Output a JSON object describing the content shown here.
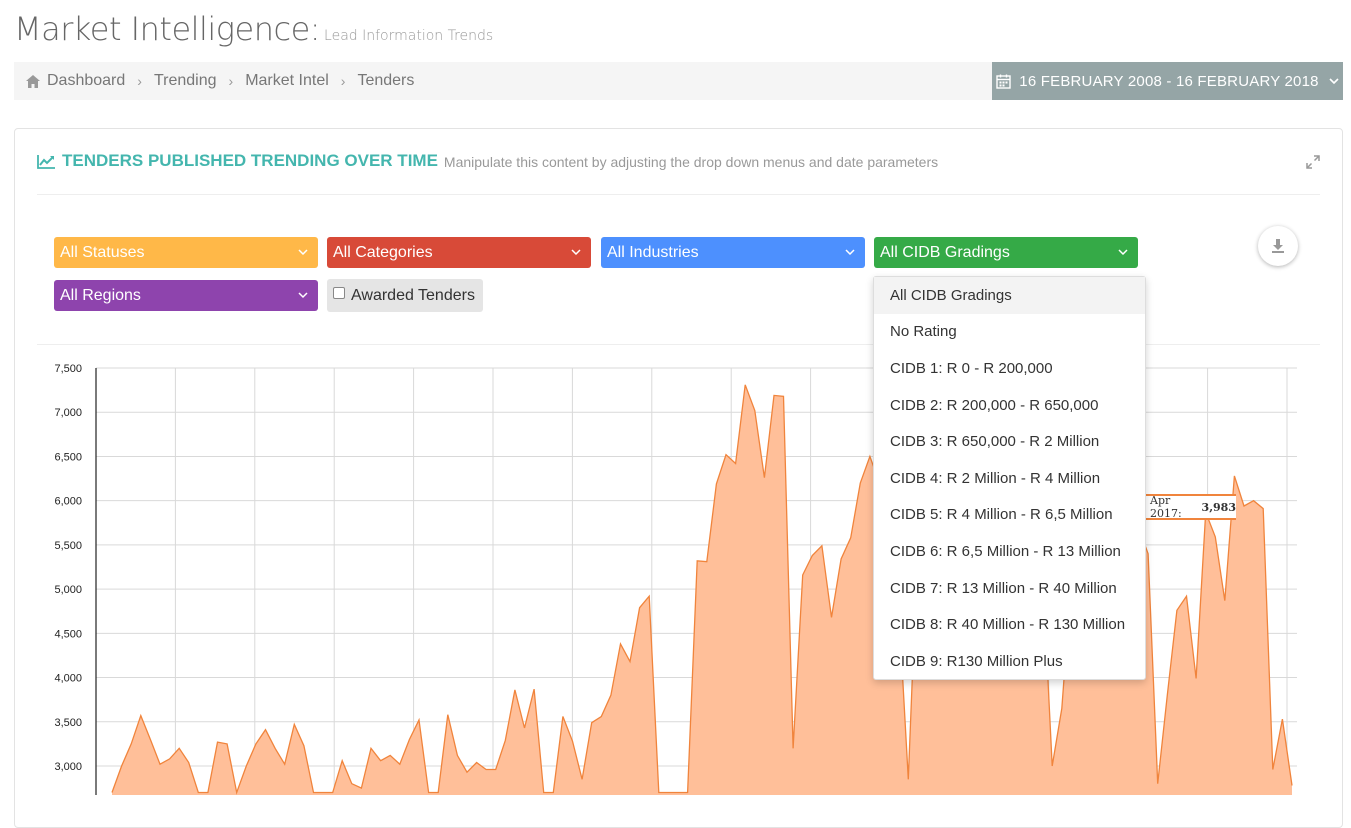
{
  "header": {
    "title": "Market Intelligence:",
    "subtitle": "Lead Information Trends"
  },
  "breadcrumb": [
    "Dashboard",
    "Trending",
    "Market Intel",
    "Tenders"
  ],
  "daterange": {
    "label": "16 FEBRUARY 2008 - 16 FEBRUARY 2018"
  },
  "portlet": {
    "title": "TENDERS PUBLISHED TRENDING OVER TIME",
    "subtitle": "Manipulate this content by adjusting the drop down menus and date parameters",
    "accent": "#44b6ae"
  },
  "filters": {
    "status": "All Statuses",
    "categories": "All Categories",
    "industries": "All Industries",
    "cidb": "All CIDB Gradings",
    "regions": "All Regions",
    "awarded": "Awarded Tenders"
  },
  "cidb_options": [
    "All CIDB Gradings",
    "No Rating",
    "CIDB 1: R 0 - R 200,000",
    "CIDB 2: R 200,000 - R 650,000",
    "CIDB 3: R 650,000 - R 2 Million",
    "CIDB 4: R 2 Million - R 4 Million",
    "CIDB 5: R 4 Million - R 6,5 Million",
    "CIDB 6: R 6,5 Million - R 13 Million",
    "CIDB 7: R 13 Million - R 40 Million",
    "CIDB 8: R 40 Million - R 130 Million",
    "CIDB 9: R130 Million Plus"
  ],
  "tooltip": {
    "label": "Apr 2017:",
    "value": "3,983"
  },
  "icons": [
    "home-icon",
    "calendar-icon",
    "chevron-down-icon",
    "chart-line-icon",
    "expand-icon",
    "download-icon"
  ],
  "chart_data": {
    "type": "area",
    "ylim": [
      2700,
      7500
    ],
    "yticks": [
      "7,500",
      "7,000",
      "6,500",
      "6,000",
      "5,500",
      "5,000",
      "4,500",
      "4,000",
      "3,500",
      "3,000"
    ],
    "yticks_values": [
      7500,
      7000,
      6500,
      6000,
      5500,
      5000,
      4500,
      4000,
      3500,
      3000
    ],
    "series": [
      {
        "color": "#f0843c",
        "fill": "#ffbf99",
        "values": [
          2700,
          3000,
          3250,
          3570,
          3300,
          3020,
          3080,
          3200,
          3040,
          2700,
          2700,
          3270,
          3250,
          2700,
          3000,
          3250,
          3410,
          3200,
          3020,
          3470,
          3230,
          2700,
          2700,
          2700,
          3060,
          2800,
          2750,
          3200,
          3060,
          3120,
          3020,
          3300,
          3520,
          2700,
          2700,
          3580,
          3120,
          2930,
          3040,
          2960,
          2960,
          3290,
          3860,
          3430,
          3870,
          2700,
          2700,
          3560,
          3280,
          2850,
          3490,
          3560,
          3800,
          4380,
          4180,
          4790,
          4920,
          2700,
          2700,
          2700,
          2700,
          5320,
          5310,
          6190,
          6520,
          6420,
          7310,
          7020,
          6260,
          7190,
          7180,
          3200,
          5160,
          5380,
          5490,
          4680,
          5340,
          5580,
          6200,
          6500,
          6200,
          5200,
          4800,
          2850,
          5600,
          5800,
          6300,
          6100,
          5700,
          5400,
          5200,
          5700,
          5500,
          5900,
          6000,
          5800,
          5500,
          5200,
          3000,
          3650,
          5100,
          5500,
          5800,
          6050,
          5900,
          5200,
          5500,
          5700,
          5400,
          2800,
          3800,
          4760,
          4920,
          3990,
          5870,
          5590,
          4870,
          6280,
          5940,
          6000,
          5910,
          2960,
          3530,
          2780
        ]
      }
    ]
  }
}
